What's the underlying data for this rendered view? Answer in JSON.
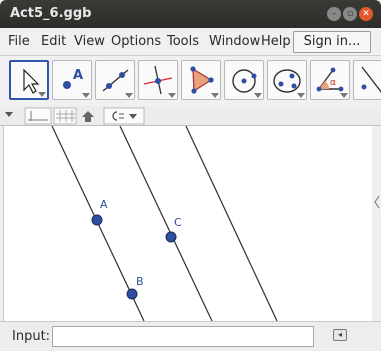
{
  "window": {
    "title": "Act5_6.ggb"
  },
  "menu": [
    "File",
    "Edit",
    "View",
    "Options",
    "Tools",
    "Window",
    "Help"
  ],
  "signin_label": "Sign in...",
  "tools": [
    {
      "name": "move-tool-icon"
    },
    {
      "name": "point-tool-icon"
    },
    {
      "name": "line-tool-icon"
    },
    {
      "name": "perpendicular-line-tool-icon"
    },
    {
      "name": "polygon-tool-icon"
    },
    {
      "name": "circle-tool-icon"
    },
    {
      "name": "ellipse-tool-icon"
    },
    {
      "name": "angle-tool-icon"
    },
    {
      "name": "reflect-tool-icon"
    }
  ],
  "points": [
    {
      "label": "A"
    },
    {
      "label": "B"
    },
    {
      "label": "C"
    }
  ],
  "input_bar": {
    "label": "Input:",
    "value": "",
    "placeholder": ""
  },
  "colors": {
    "point": "#2d4fa0",
    "line": "#333333",
    "accent": "#e2572b"
  }
}
